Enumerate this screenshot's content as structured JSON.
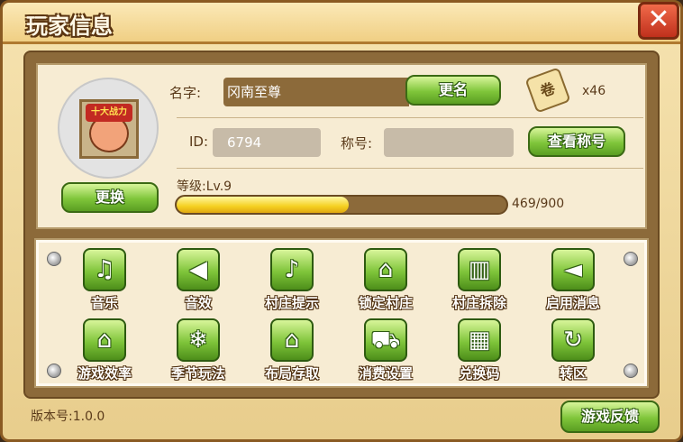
{
  "window": {
    "title": "玩家信息",
    "close_label": "✕"
  },
  "profile": {
    "avatar_badge": "十大战力",
    "change_avatar_label": "更换",
    "name_label": "名字:",
    "name_value": "冈南至尊",
    "rename_label": "更名",
    "item_icon": "scroll-icon",
    "item_count": "x46",
    "id_label": "ID:",
    "id_value": "6794",
    "title_label": "称号:",
    "title_value": "",
    "view_titles_label": "查看称号",
    "level_label": "等级:Lv.9",
    "xp_text": "469/900",
    "xp_current": 469,
    "xp_max": 900
  },
  "settings": [
    {
      "label": "音乐",
      "icon": "music-note-icon",
      "glyph": "♫"
    },
    {
      "label": "音效",
      "icon": "speaker-icon",
      "glyph": "◀"
    },
    {
      "label": "村庄提示",
      "icon": "bell-icon",
      "glyph": "♪"
    },
    {
      "label": "锁定村庄",
      "icon": "house-lock-icon",
      "glyph": "⌂"
    },
    {
      "label": "村庄拆除",
      "icon": "trash-icon",
      "glyph": "▥"
    },
    {
      "label": "启用消息",
      "icon": "megaphone-icon",
      "glyph": "◄"
    },
    {
      "label": "游戏效率",
      "icon": "house-tools-icon",
      "glyph": "⌂"
    },
    {
      "label": "季节玩法",
      "icon": "snowflake-icon",
      "glyph": "❄"
    },
    {
      "label": "布局存取",
      "icon": "house-layout-icon",
      "glyph": "⌂"
    },
    {
      "label": "消费设置",
      "icon": "cart-icon",
      "glyph": "⛟"
    },
    {
      "label": "兑换码",
      "icon": "qr-code-icon",
      "glyph": "▦"
    },
    {
      "label": "转区",
      "icon": "refresh-icon",
      "glyph": "↻"
    }
  ],
  "footer": {
    "version": "版本号:1.0.0",
    "feedback_label": "游戏反馈"
  }
}
